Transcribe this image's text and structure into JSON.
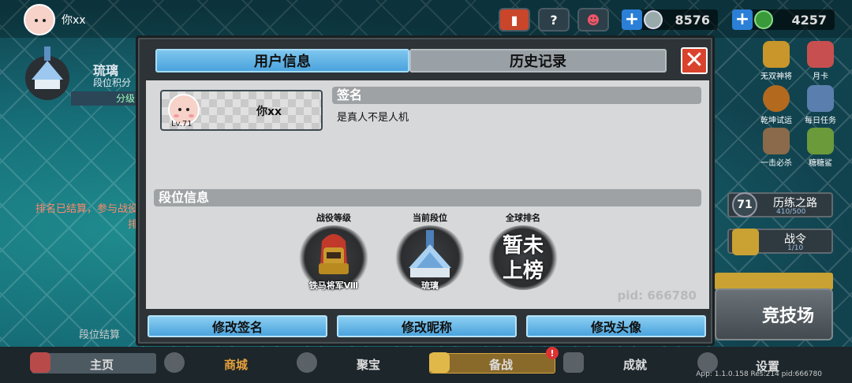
{
  "topbar": {
    "username": "你xx",
    "currency1": "8576",
    "currency2": "4257",
    "icons": [
      "book-icon",
      "help-icon",
      "friends-icon"
    ]
  },
  "left": {
    "rank_name": "琉璃",
    "rank_points_label": "段位积分",
    "score_label": "分级",
    "notice_line1": "排名已结算，参与战役",
    "notice_line2": "排",
    "settle_label": "段位结算"
  },
  "right": {
    "features": [
      "无双神将",
      "月卡",
      "乾坤试运",
      "每日任务",
      "一击必杀",
      "糖糖鲨"
    ],
    "level": "71",
    "path_title": "历练之路",
    "path_progress": "410/500",
    "battle_pass": "战令",
    "battle_pass_progress": "1/10",
    "arena": "竞技场"
  },
  "bottom": {
    "nav": [
      "主页",
      "商城",
      "聚宝",
      "备战",
      "成就",
      "设置"
    ],
    "badge": "!",
    "app_info": "App: 1.1.0.158 Res:214 pid:666780"
  },
  "dialog": {
    "tabs": [
      "用户信息",
      "历史记录"
    ],
    "close": "✕",
    "profile": {
      "name": "你xx",
      "level": "Lv.71"
    },
    "signature_header": "签名",
    "signature": "是真人不是人机",
    "rank_header": "段位信息",
    "ranks": [
      {
        "label": "战役等级",
        "value": "铁马将军Ⅷ"
      },
      {
        "label": "当前段位",
        "value": "琉璃"
      },
      {
        "label": "全球排名",
        "line1": "暂未",
        "line2": "上榜"
      }
    ],
    "pid": "pid: 666780",
    "buttons": [
      "修改签名",
      "修改昵称",
      "修改头像"
    ]
  },
  "colors": {
    "accent": "#4aa3dd",
    "close": "#d9432e",
    "panel": "#d7d8d9"
  }
}
